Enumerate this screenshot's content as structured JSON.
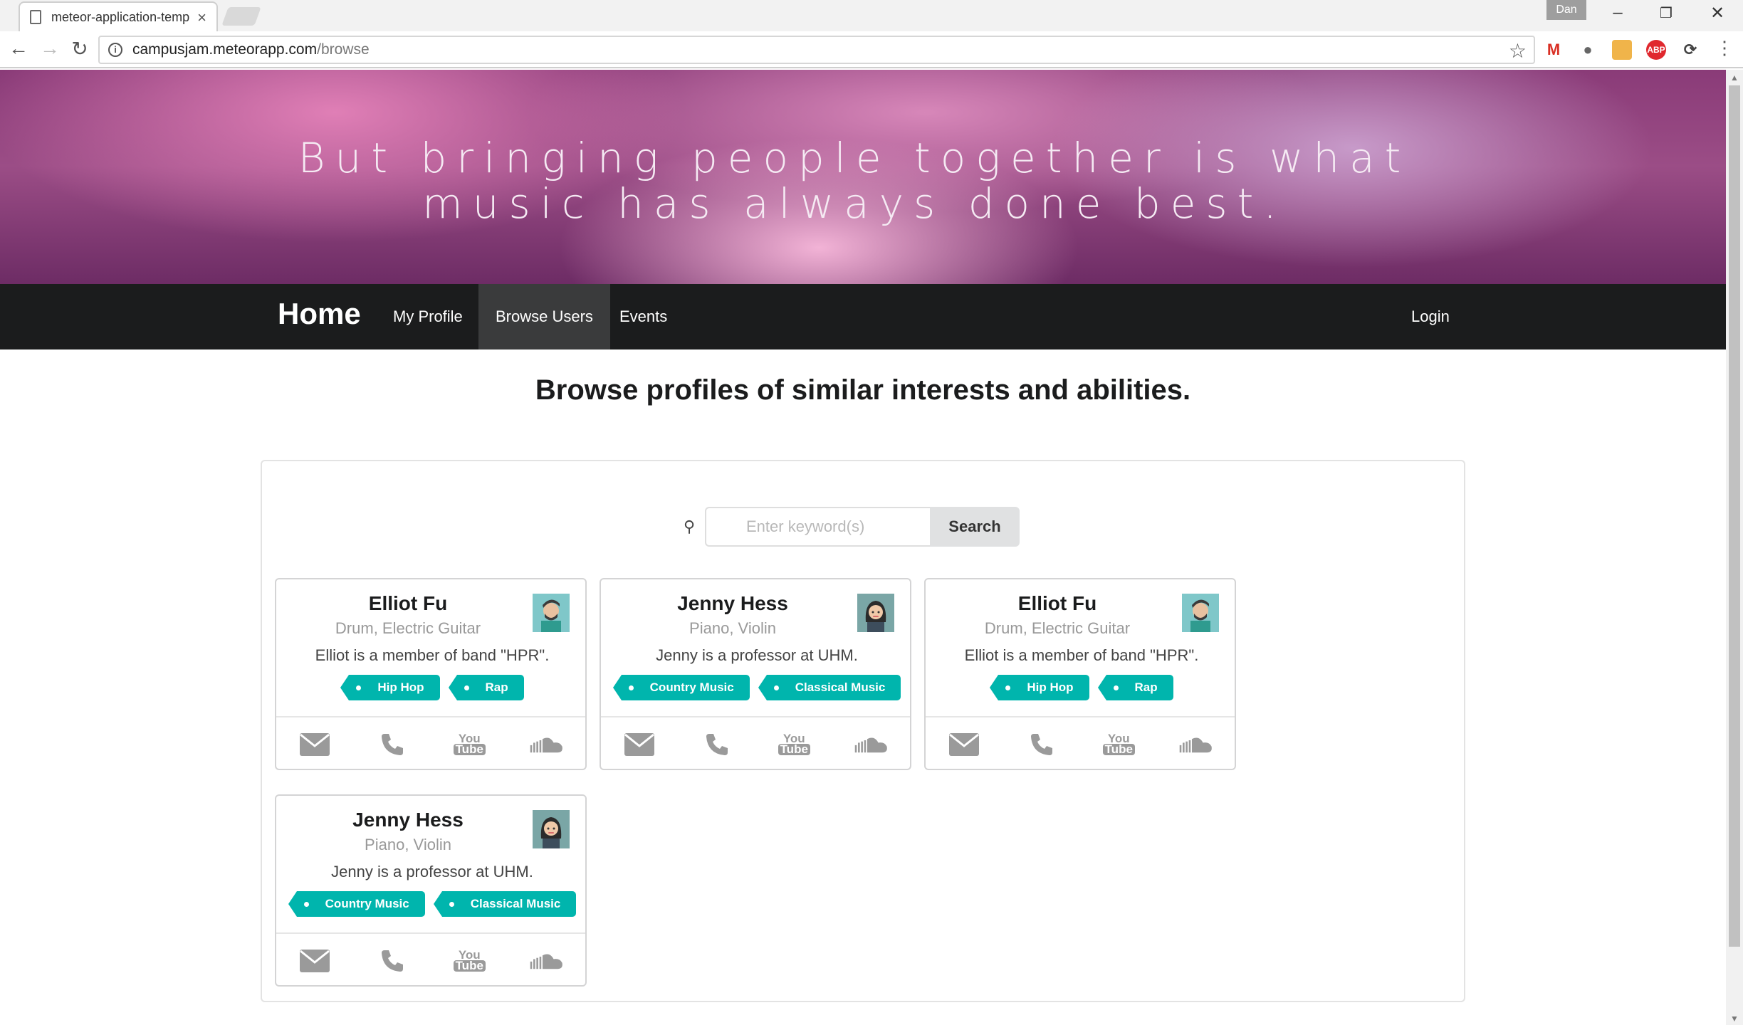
{
  "browser": {
    "tab_title": "meteor-application-temp",
    "tab_close": "×",
    "profile_name": "Dan",
    "url_host": "campusjam.meteorapp.com",
    "url_path": "/browse"
  },
  "banner": {
    "quote": "But bringing people together is what music has always done best."
  },
  "nav": {
    "brand": "Home",
    "items": [
      {
        "label": "My Profile"
      },
      {
        "label": "Browse Users"
      },
      {
        "label": "Events"
      }
    ],
    "login": "Login",
    "active_index": 1
  },
  "page": {
    "title": "Browse profiles of similar interests and abilities."
  },
  "search": {
    "placeholder": "Enter keyword(s)",
    "button": "Search"
  },
  "profiles": [
    {
      "name": "Elliot Fu",
      "instruments": "Drum, Electric Guitar",
      "description": "Elliot is a member of band \"HPR\".",
      "tags": [
        "Hip Hop",
        "Rap"
      ],
      "avatar": "man-avatar"
    },
    {
      "name": "Jenny Hess",
      "instruments": "Piano, Violin",
      "description": "Jenny is a professor at UHM.",
      "tags": [
        "Country Music",
        "Classical Music"
      ],
      "avatar": "woman-avatar"
    },
    {
      "name": "Elliot Fu",
      "instruments": "Drum, Electric Guitar",
      "description": "Elliot is a member of band \"HPR\".",
      "tags": [
        "Hip Hop",
        "Rap"
      ],
      "avatar": "man-avatar"
    },
    {
      "name": "Jenny Hess",
      "instruments": "Piano, Violin",
      "description": "Jenny is a professor at UHM.",
      "tags": [
        "Country Music",
        "Classical Music"
      ],
      "avatar": "woman-avatar"
    }
  ],
  "contact_icons": [
    "mail-icon",
    "phone-icon",
    "youtube-icon",
    "soundcloud-icon"
  ],
  "youtube_text": {
    "you": "You",
    "tube": "Tube"
  },
  "colors": {
    "accent": "#00b5ad",
    "navbar": "#1b1c1d",
    "nav_active": "#3a3b3c",
    "icon_gray": "#9a9a9a"
  }
}
